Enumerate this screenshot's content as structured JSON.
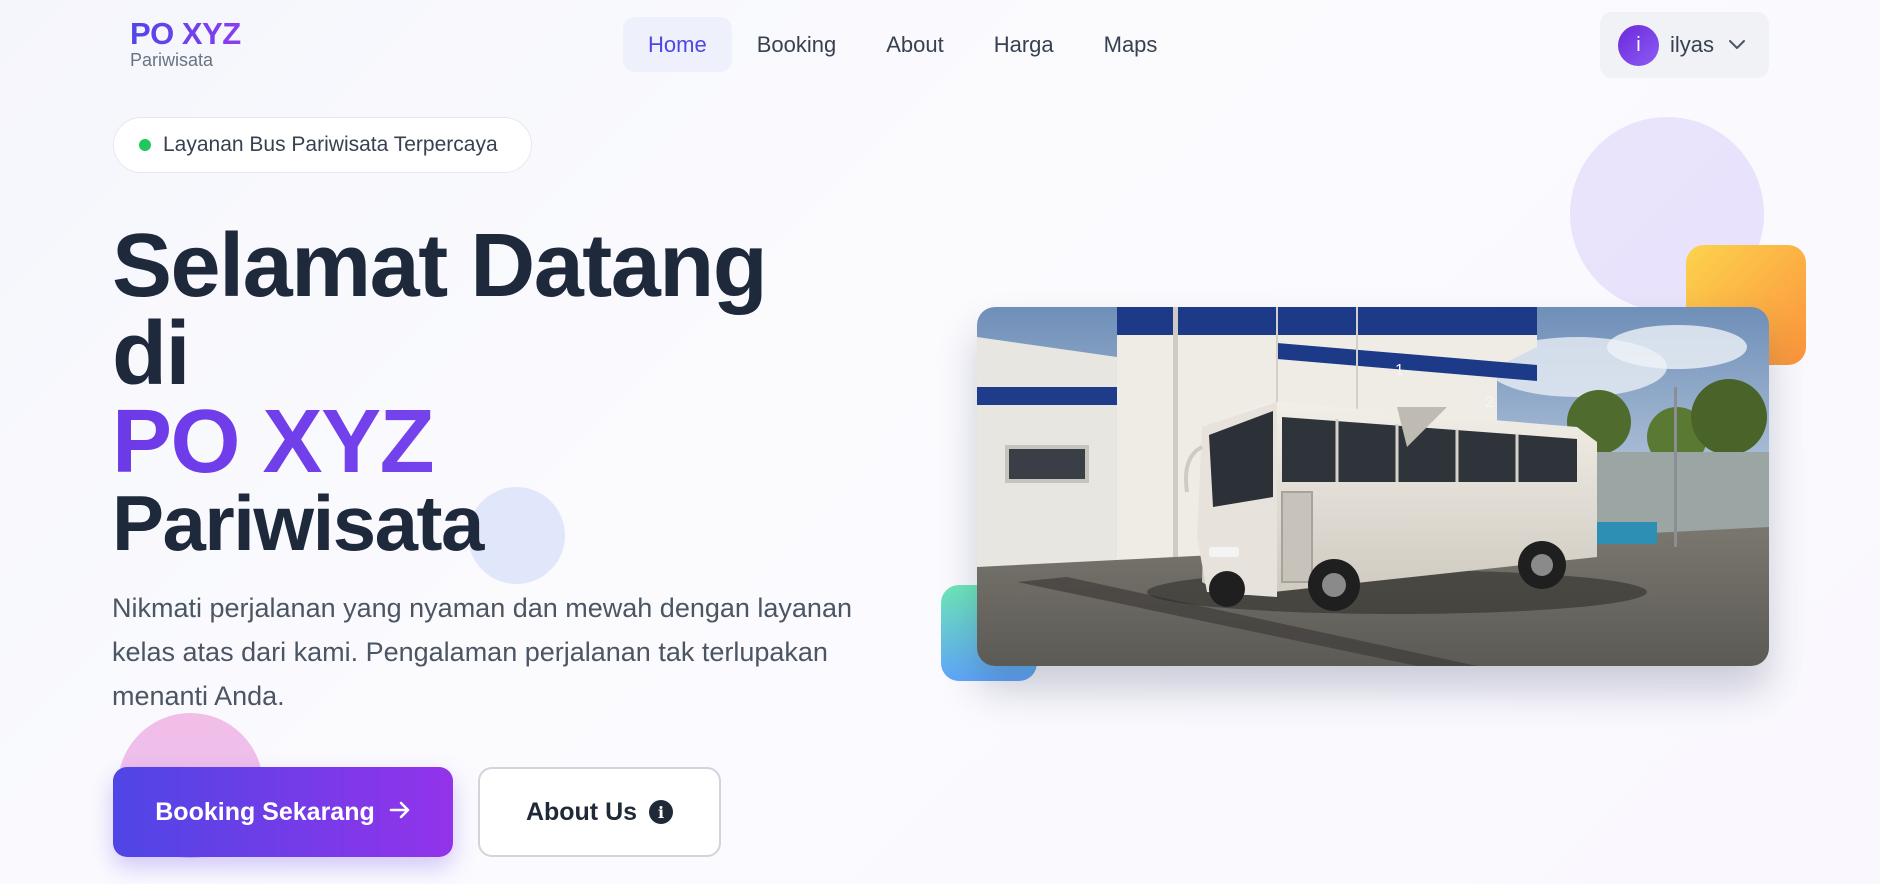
{
  "nav": {
    "logo_title": "PO XYZ",
    "logo_subtitle": "Pariwisata",
    "items": [
      {
        "label": "Home",
        "active": true
      },
      {
        "label": "Booking"
      },
      {
        "label": "About"
      },
      {
        "label": "Harga"
      },
      {
        "label": "Maps"
      }
    ],
    "user": {
      "initial": "i",
      "name": "ilyas",
      "icon": "chevron-down-icon"
    }
  },
  "hero": {
    "badge_text": "Layanan Bus Pariwisata Terpercaya",
    "badge_icon": "status-dot-icon",
    "heading_line1": "Selamat Datang",
    "heading_line2": "di",
    "heading_brand": "PO XYZ",
    "heading_line3": "Pariwisata",
    "description": "Nikmati perjalanan yang nyaman dan mewah dengan layanan kelas atas dari kami. Pengalaman perjalanan tak terlupakan menanti Anda.",
    "primary_button": "Booking Sekarang",
    "primary_icon": "arrow-right-icon",
    "secondary_button": "About Us",
    "secondary_icon": "info-icon",
    "image_numbers": [
      "1",
      "2"
    ]
  },
  "colors": {
    "accent": "#4f46e5",
    "accent_end": "#9333ea",
    "heading": "#1e293b",
    "badge_dot": "#22c55e"
  }
}
